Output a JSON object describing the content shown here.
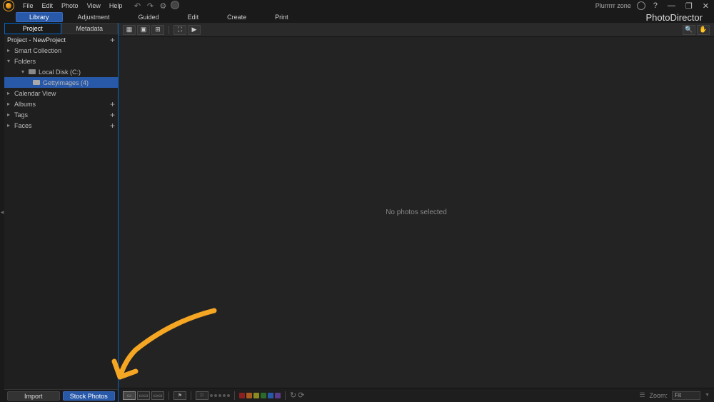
{
  "app": {
    "brand": "PhotoDirector",
    "user": "Plurrrrr zone"
  },
  "menu": {
    "file": "File",
    "edit": "Edit",
    "photo": "Photo",
    "view": "View",
    "help": "Help"
  },
  "modules": {
    "library": "Library",
    "adjustment": "Adjustment",
    "guided": "Guided",
    "edit": "Edit",
    "create": "Create",
    "print": "Print"
  },
  "panel": {
    "tabs": {
      "project": "Project",
      "metadata": "Metadata"
    },
    "project_header": "Project - NewProject",
    "smart_collection": "Smart Collection",
    "folders": "Folders",
    "local_disk": "Local Disk (C:)",
    "subfolder": "Gettyimages (4)",
    "calendar_view": "Calendar View",
    "albums": "Albums",
    "tags": "Tags",
    "faces": "Faces"
  },
  "buttons": {
    "import": "Import",
    "stock_photos": "Stock Photos"
  },
  "viewer": {
    "empty": "No photos selected"
  },
  "bottom": {
    "zoom_label": "Zoom:",
    "zoom_value": "Fit"
  },
  "colors": {
    "swatches": [
      "#8b2020",
      "#a85a20",
      "#8b8b20",
      "#2a6a2a",
      "#2858a8",
      "#5a3a8b"
    ]
  }
}
